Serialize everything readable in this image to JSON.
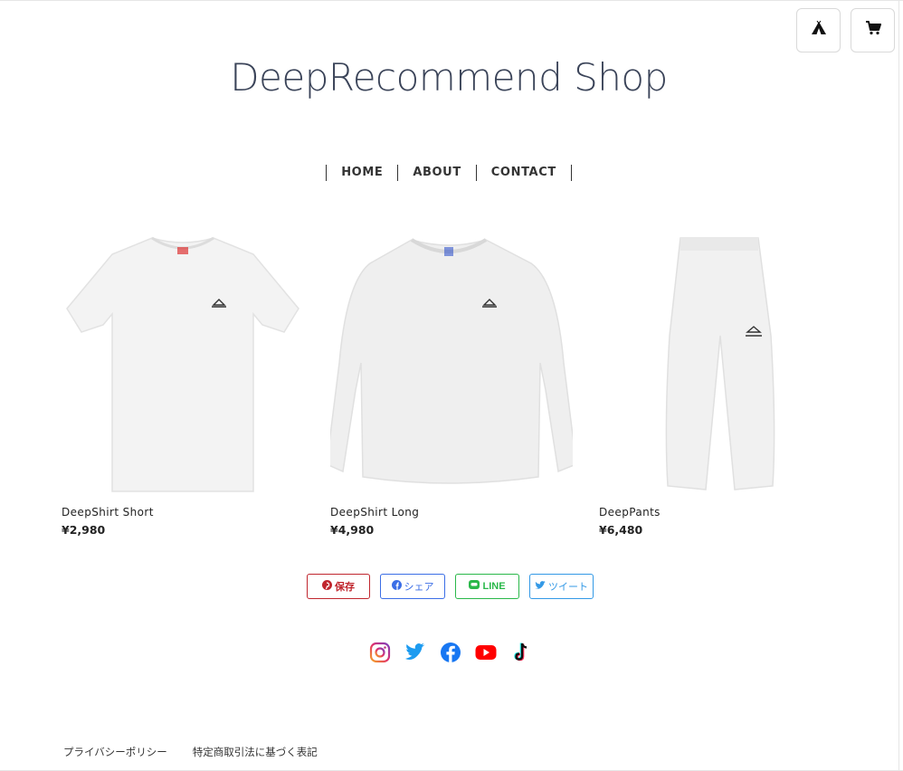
{
  "header": {
    "title": "DeepRecommend Shop",
    "home_icon": "tent-icon",
    "cart_icon": "cart-icon"
  },
  "nav": {
    "items": [
      "HOME",
      "ABOUT",
      "CONTACT"
    ]
  },
  "products": [
    {
      "name": "DeepShirt Short",
      "price": "¥2,980",
      "image": "white-tshirt"
    },
    {
      "name": "DeepShirt Long",
      "price": "¥4,980",
      "image": "white-sweatshirt"
    },
    {
      "name": "DeepPants",
      "price": "¥6,480",
      "image": "white-sweatpants"
    }
  ],
  "share": {
    "pinterest": "保存",
    "facebook": "シェア",
    "line": "LINE",
    "twitter": "ツイート"
  },
  "social_icons": [
    "instagram-icon",
    "twitter-icon",
    "facebook-icon",
    "youtube-icon",
    "tiktok-icon"
  ],
  "footer": {
    "privacy": "プライバシーポリシー",
    "legal": "特定商取引法に基づく表記"
  },
  "colors": {
    "title": "#3b4459",
    "pinterest": "#c0262e",
    "facebook": "#3b6ee6",
    "line": "#2ab84a",
    "twitter": "#3399e6"
  }
}
